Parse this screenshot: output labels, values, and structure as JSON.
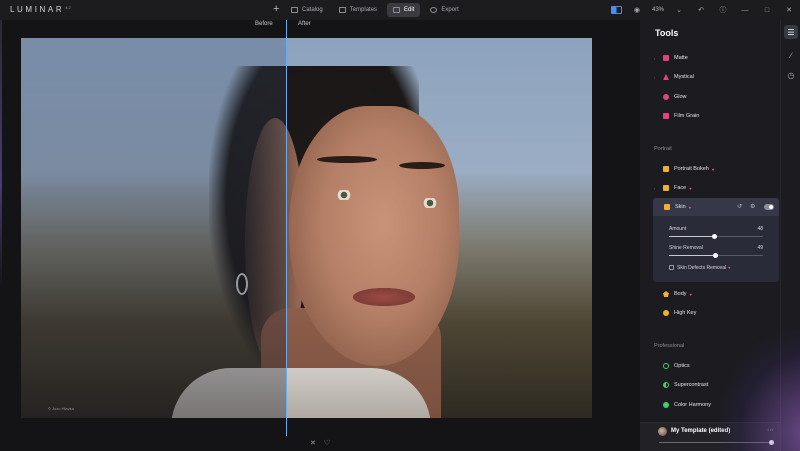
{
  "app": {
    "name": "LUMINAR",
    "version": "4.2"
  },
  "topbar": {
    "add_icon": "plus-icon",
    "nav": [
      {
        "label": "Catalog",
        "icon": "folder-icon",
        "active": false
      },
      {
        "label": "Templates",
        "icon": "templates-icon",
        "active": false
      },
      {
        "label": "Edit",
        "icon": "edit-icon",
        "active": true
      },
      {
        "label": "Export",
        "icon": "export-icon",
        "active": false
      }
    ],
    "zoom": "43%",
    "icons": [
      "compare-icon",
      "eye-icon",
      "undo-icon",
      "info-icon",
      "minimize-icon",
      "maximize-icon",
      "close-icon"
    ]
  },
  "canvas": {
    "before_label": "Before",
    "after_label": "After",
    "photo_credit": "© Jozo Hlavka"
  },
  "bottom_controls": {
    "close_icon": "close-icon",
    "heart_icon": "heart-icon"
  },
  "panel": {
    "title": "Tools",
    "tools_top": [
      {
        "label": "Matte",
        "icon": "matte-icon",
        "color": "#e0457a"
      },
      {
        "label": "Mystical",
        "icon": "mystical-icon",
        "color": "#e0457a"
      },
      {
        "label": "Glow",
        "icon": "glow-icon",
        "color": "#e0457a"
      },
      {
        "label": "Film Grain",
        "icon": "film-grain-icon",
        "color": "#e0457a"
      }
    ],
    "section_portrait": "Portrait",
    "portrait_tools": [
      {
        "label": "Portrait Bokeh",
        "icon": "portrait-bokeh-icon",
        "color": "#f0b030"
      },
      {
        "label": "Face",
        "icon": "face-icon",
        "color": "#f0b030"
      }
    ],
    "skin": {
      "label": "Skin",
      "icon": "skin-icon",
      "color": "#f0b030",
      "sliders": [
        {
          "label": "Amount",
          "value": 48,
          "fraction": 0.48
        },
        {
          "label": "Shine Removal",
          "value": 49,
          "fraction": 0.49
        }
      ],
      "checkbox_label": "Skin Defects Removal"
    },
    "portrait_tools_after": [
      {
        "label": "Body",
        "icon": "body-icon",
        "color": "#f0b030"
      },
      {
        "label": "High Key",
        "icon": "high-key-icon",
        "color": "#f0b030"
      }
    ],
    "section_professional": "Professional",
    "professional_tools": [
      {
        "label": "Optics",
        "icon": "optics-icon",
        "color": "#3ecf6a"
      },
      {
        "label": "Supercontrast",
        "icon": "supercontrast-icon",
        "color": "#3ecf6a"
      },
      {
        "label": "Color Harmony",
        "icon": "color-harmony-icon",
        "color": "#3ecf6a"
      }
    ]
  },
  "sidebar": {
    "icons": [
      "sliders-icon",
      "brush-icon",
      "history-icon"
    ]
  },
  "template": {
    "name": "My Template (edited)",
    "more_icon": "more-icon",
    "amount_fraction": 1.0
  }
}
